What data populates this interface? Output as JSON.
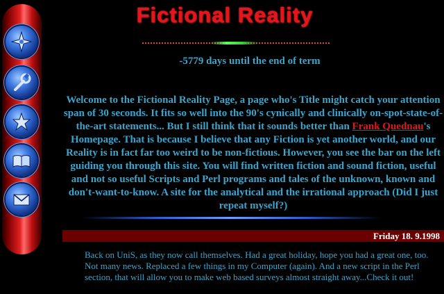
{
  "page": {
    "title": "Fictional Reality",
    "countdown": "-5779 days until the end of term"
  },
  "navbar": {
    "buttons": [
      {
        "icon": "compass-star-icon"
      },
      {
        "icon": "wrench-icon"
      },
      {
        "icon": "star-icon"
      },
      {
        "icon": "book-icon"
      },
      {
        "icon": "envelope-icon"
      }
    ]
  },
  "intro": {
    "text_before_link": "Welcome to the Fictional Reality Page, a page who's Title might catch your attention span of 30 seconds. It fits so well into the 90's cynically and clinically on-spot-state-of-the-art statements... But I still think that it sounds better than ",
    "link_text": "Frank Quednau",
    "text_after_link": "'s Homepage. That is because I believe that any Fiction is yet another world, and our Reality is in fact far too weird to be non-fictious. However, you see the bar on the left guiding you through this site. You will find written fiction and sound fiction, useful and not so useful Scripts and Perl programs and tales of the unknown, known and don't-want-to-know. A site for the analytical and the irrational approach (Did I just repeat myself?)"
  },
  "news": {
    "date": "Friday 18. 9.1998",
    "body": "Back on UniS, as they now call themselves. Had a great holiday, hope you had a great one, too. Not many news. Replaced a few things in my Computer (again). And a new script in the Perl section, that will allow you to make web based surveys almost straight away...Check it out!"
  },
  "colors": {
    "background": "#000000",
    "title_red": "#e8141c",
    "text_blue": "#3aa6ce",
    "news_header": "#6b0000"
  }
}
